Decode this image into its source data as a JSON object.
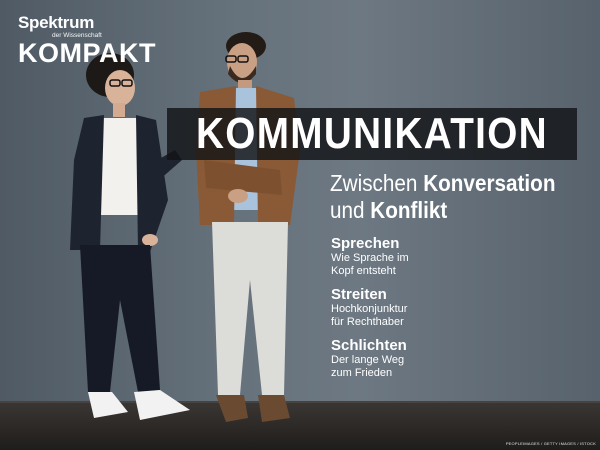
{
  "brand": {
    "line1": "Spektrum",
    "line2": "der Wissenschaft",
    "line3": "KOMPAKT"
  },
  "cover": {
    "title": "KOMMUNIKATION",
    "subtitle_prefix1": "Zwischen ",
    "subtitle_bold1": "Konversation",
    "subtitle_prefix2": "und ",
    "subtitle_bold2": "Konflikt"
  },
  "sections": [
    {
      "heading": "Sprechen",
      "line1": "Wie Sprache im",
      "line2": "Kopf entsteht"
    },
    {
      "heading": "Streiten",
      "line1": "Hochkonjunktur",
      "line2": "für Rechthaber"
    },
    {
      "heading": "Schlichten",
      "line1": "Der lange Weg",
      "line2": "zum Frieden"
    }
  ],
  "credit": "PEOPLEIMAGES / GETTY IMAGES / ISTOCK",
  "colors": {
    "wall": "#66727c",
    "floor": "#2a2725",
    "title_box": "#121416",
    "text": "#ffffff"
  }
}
